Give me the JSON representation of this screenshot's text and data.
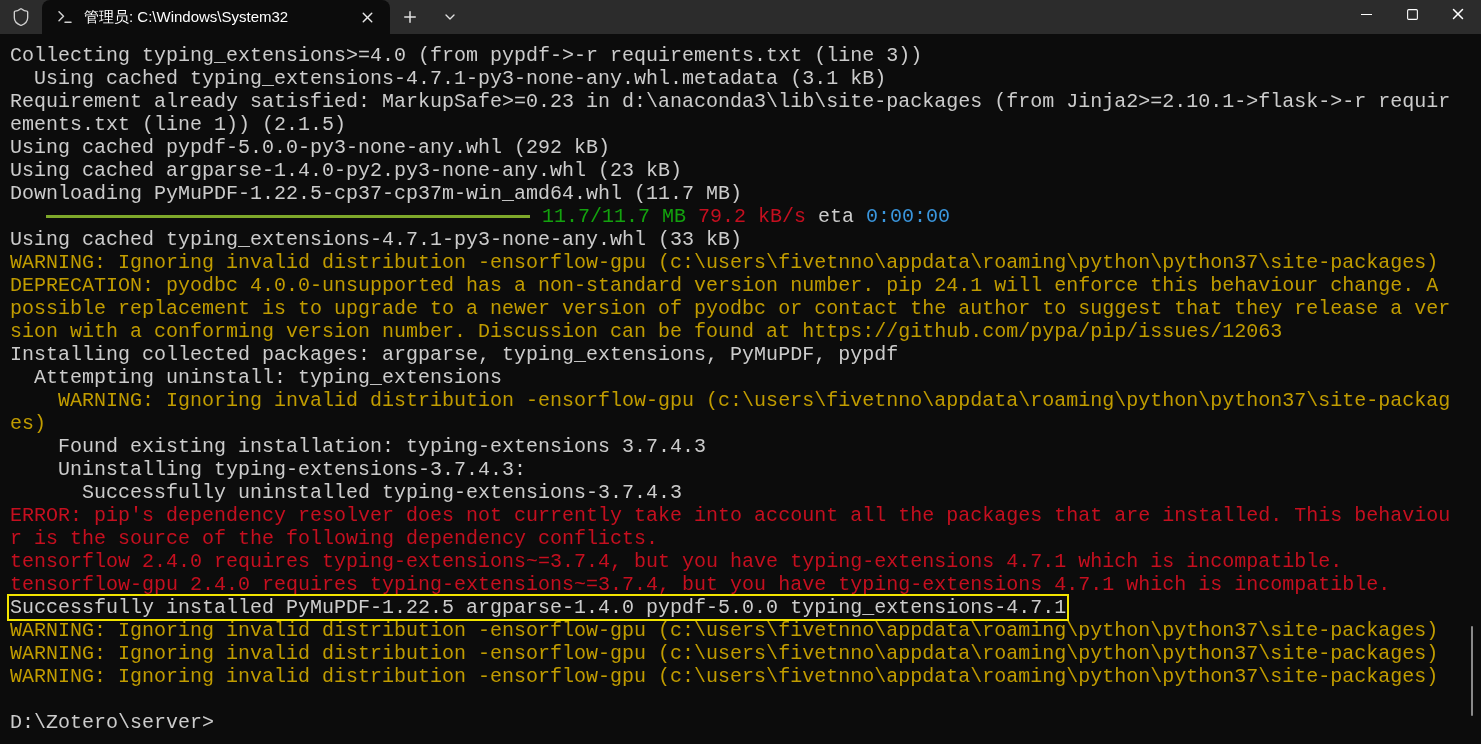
{
  "tab": {
    "title": "管理员: C:\\Windows\\System32",
    "selected": true
  },
  "lines": [
    {
      "kind": "text",
      "color": "#cccccc",
      "text": "Collecting typing_extensions>=4.0 (from pypdf->-r requirements.txt (line 3))"
    },
    {
      "kind": "text",
      "color": "#cccccc",
      "text": "  Using cached typing_extensions-4.7.1-py3-none-any.whl.metadata (3.1 kB)"
    },
    {
      "kind": "text",
      "color": "#cccccc",
      "text": "Requirement already satisfied: MarkupSafe>=0.23 in d:\\anaconda3\\lib\\site-packages (from Jinja2>=2.10.1->flask->-r requir"
    },
    {
      "kind": "text",
      "color": "#cccccc",
      "text": "ements.txt (line 1)) (2.1.5)"
    },
    {
      "kind": "text",
      "color": "#cccccc",
      "text": "Using cached pypdf-5.0.0-py3-none-any.whl (292 kB)"
    },
    {
      "kind": "text",
      "color": "#cccccc",
      "text": "Using cached argparse-1.4.0-py2.py3-none-any.whl (23 kB)"
    },
    {
      "kind": "text",
      "color": "#cccccc",
      "text": "Downloading PyMuPDF-1.22.5-cp37-cp37m-win_amd64.whl (11.7 MB)"
    },
    {
      "kind": "progress",
      "level": 1,
      "segments": [
        {
          "text": "11.7/11.7 MB",
          "color": "#13a10e"
        },
        {
          "text": "79.2 kB/s",
          "color": "#c50f1f"
        },
        {
          "text": "eta",
          "color": "#cccccc"
        },
        {
          "text": "0:00:00",
          "color": "#3a96dd"
        }
      ]
    },
    {
      "kind": "text",
      "color": "#cccccc",
      "text": "Using cached typing_extensions-4.7.1-py3-none-any.whl (33 kB)"
    },
    {
      "kind": "text",
      "color": "#c19c00",
      "text": "WARNING: Ignoring invalid distribution -ensorflow-gpu (c:\\users\\fivetnno\\appdata\\roaming\\python\\python37\\site-packages)"
    },
    {
      "kind": "text",
      "color": "#c19c00",
      "text": "DEPRECATION: pyodbc 4.0.0-unsupported has a non-standard version number. pip 24.1 will enforce this behaviour change. A"
    },
    {
      "kind": "text",
      "color": "#c19c00",
      "text": "possible replacement is to upgrade to a newer version of pyodbc or contact the author to suggest that they release a ver"
    },
    {
      "kind": "text",
      "color": "#c19c00",
      "text": "sion with a conforming version number. Discussion can be found at https://github.com/pypa/pip/issues/12063"
    },
    {
      "kind": "text",
      "color": "#cccccc",
      "text": "Installing collected packages: argparse, typing_extensions, PyMuPDF, pypdf"
    },
    {
      "kind": "text",
      "color": "#cccccc",
      "text": "  Attempting uninstall: typing_extensions"
    },
    {
      "kind": "text",
      "color": "#c19c00",
      "text": "    WARNING: Ignoring invalid distribution -ensorflow-gpu (c:\\users\\fivetnno\\appdata\\roaming\\python\\python37\\site-packag"
    },
    {
      "kind": "text",
      "color": "#c19c00",
      "text": "es)"
    },
    {
      "kind": "text",
      "color": "#cccccc",
      "text": "    Found existing installation: typing-extensions 3.7.4.3"
    },
    {
      "kind": "text",
      "color": "#cccccc",
      "text": "    Uninstalling typing-extensions-3.7.4.3:"
    },
    {
      "kind": "text",
      "color": "#cccccc",
      "text": "      Successfully uninstalled typing-extensions-3.7.4.3"
    },
    {
      "kind": "text",
      "color": "#c50f1f",
      "text": "ERROR: pip's dependency resolver does not currently take into account all the packages that are installed. This behaviou"
    },
    {
      "kind": "text",
      "color": "#c50f1f",
      "text": "r is the source of the following dependency conflicts."
    },
    {
      "kind": "text",
      "color": "#c50f1f",
      "text": "tensorflow 2.4.0 requires typing-extensions~=3.7.4, but you have typing-extensions 4.7.1 which is incompatible."
    },
    {
      "kind": "text",
      "color": "#c50f1f",
      "text": "tensorflow-gpu 2.4.0 requires typing-extensions~=3.7.4, but you have typing-extensions 4.7.1 which is incompatible."
    },
    {
      "kind": "text",
      "color": "#cccccc",
      "highlighted": true,
      "text": "Successfully installed PyMuPDF-1.22.5 argparse-1.4.0 pypdf-5.0.0 typing_extensions-4.7.1"
    },
    {
      "kind": "text",
      "color": "#c19c00",
      "text": "WARNING: Ignoring invalid distribution -ensorflow-gpu (c:\\users\\fivetnno\\appdata\\roaming\\python\\python37\\site-packages)"
    },
    {
      "kind": "text",
      "color": "#c19c00",
      "text": "WARNING: Ignoring invalid distribution -ensorflow-gpu (c:\\users\\fivetnno\\appdata\\roaming\\python\\python37\\site-packages)"
    },
    {
      "kind": "text",
      "color": "#c19c00",
      "text": "WARNING: Ignoring invalid distribution -ensorflow-gpu (c:\\users\\fivetnno\\appdata\\roaming\\python\\python37\\site-packages)"
    },
    {
      "kind": "blank"
    },
    {
      "kind": "text",
      "color": "#cccccc",
      "text": "D:\\Zotero\\server>"
    }
  ]
}
